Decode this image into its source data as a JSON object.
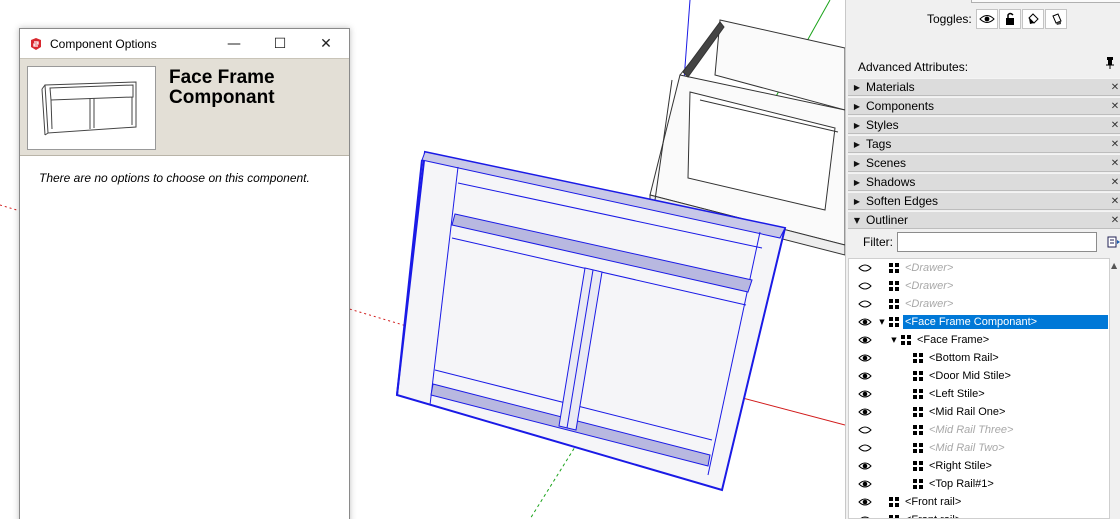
{
  "component_window": {
    "title": "Component Options",
    "minimize": "—",
    "maximize": "☐",
    "close": "✕",
    "component_name": "Face Frame Componant",
    "message": "There are no options to choose on this component."
  },
  "tray": {
    "toggles_label": "Toggles:",
    "advanced_attributes_label": "Advanced Attributes:",
    "panels": [
      {
        "label": "Materials",
        "expanded": false
      },
      {
        "label": "Components",
        "expanded": false
      },
      {
        "label": "Styles",
        "expanded": false
      },
      {
        "label": "Tags",
        "expanded": false
      },
      {
        "label": "Scenes",
        "expanded": false
      },
      {
        "label": "Shadows",
        "expanded": false
      },
      {
        "label": "Soften Edges",
        "expanded": false
      },
      {
        "label": "Outliner",
        "expanded": true
      }
    ],
    "filter_label": "Filter:",
    "filter_value": "",
    "outliner_items": [
      {
        "name": "<Drawer>",
        "visible": false,
        "level": 0,
        "expander": "",
        "selected": false
      },
      {
        "name": "<Drawer>",
        "visible": false,
        "level": 0,
        "expander": "",
        "selected": false
      },
      {
        "name": "<Drawer>",
        "visible": false,
        "level": 0,
        "expander": "",
        "selected": false
      },
      {
        "name": "<Face Frame Componant>",
        "visible": true,
        "level": 0,
        "expander": "▼",
        "selected": true
      },
      {
        "name": "<Face Frame>",
        "visible": true,
        "level": 1,
        "expander": "▼",
        "selected": false
      },
      {
        "name": "<Bottom Rail>",
        "visible": true,
        "level": 2,
        "expander": "",
        "selected": false
      },
      {
        "name": "<Door Mid Stile>",
        "visible": true,
        "level": 2,
        "expander": "",
        "selected": false
      },
      {
        "name": "<Left Stile>",
        "visible": true,
        "level": 2,
        "expander": "",
        "selected": false
      },
      {
        "name": "<Mid Rail One>",
        "visible": true,
        "level": 2,
        "expander": "",
        "selected": false
      },
      {
        "name": "<Mid Rail Three>",
        "visible": false,
        "level": 2,
        "expander": "",
        "selected": false
      },
      {
        "name": "<Mid Rail Two>",
        "visible": false,
        "level": 2,
        "expander": "",
        "selected": false
      },
      {
        "name": "<Right Stile>",
        "visible": true,
        "level": 2,
        "expander": "",
        "selected": false
      },
      {
        "name": "<Top Rail#1>",
        "visible": true,
        "level": 2,
        "expander": "",
        "selected": false
      },
      {
        "name": "<Front rail>",
        "visible": true,
        "level": 0,
        "expander": "",
        "selected": false
      },
      {
        "name": "<Front rail>",
        "visible": true,
        "level": 0,
        "expander": "",
        "selected": false
      }
    ]
  },
  "colors": {
    "selection": "#0078d7",
    "selected_geometry": "#1a1ae6",
    "axis_red": "#d11a1a",
    "axis_green": "#1aa31a",
    "axis_blue": "#1a1ae6"
  }
}
